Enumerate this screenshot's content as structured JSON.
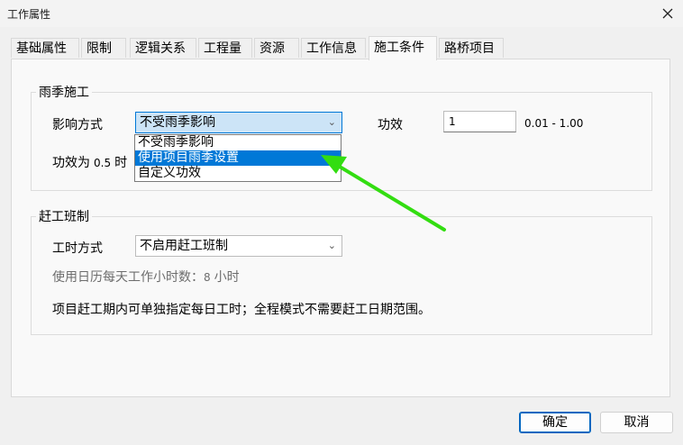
{
  "window": {
    "title": "工作属性"
  },
  "tabs": [
    "基础属性",
    "限制",
    "逻辑关系",
    "工程量",
    "资源",
    "工作信息",
    "施工条件",
    "路桥项目"
  ],
  "active_tab": "施工条件",
  "rain_group": {
    "title": "雨季施工",
    "influence_label": "影响方式",
    "influence_value": "不受雨季影响",
    "dropdown_options": [
      "不受雨季影响",
      "使用项目雨季设置",
      "自定义功效"
    ],
    "dropdown_highlighted": "使用项目雨季设置",
    "efficiency_label": "功效",
    "efficiency_value": "1",
    "efficiency_range": "0.01 - 1.00",
    "efficiency_is_prefix": "功效为",
    "efficiency_is_value": "0.5",
    "efficiency_is_suffix": "时"
  },
  "rush_group": {
    "title": "赶工班制",
    "mode_label": "工时方式",
    "mode_value": "不启用赶工班制",
    "hours_prefix": "使用日历每天工作小时数：",
    "hours_value": "8",
    "hours_suffix": "小时",
    "note": "项目赶工期内可单独指定每日工时；全程模式不需要赶工日期范围。"
  },
  "buttons": {
    "ok": "确定",
    "cancel": "取消"
  },
  "colors": {
    "accent": "#0078d7",
    "arrow": "#33dd11"
  },
  "icons": {
    "close": "close-icon",
    "dropdown": "chevron-down-icon"
  }
}
